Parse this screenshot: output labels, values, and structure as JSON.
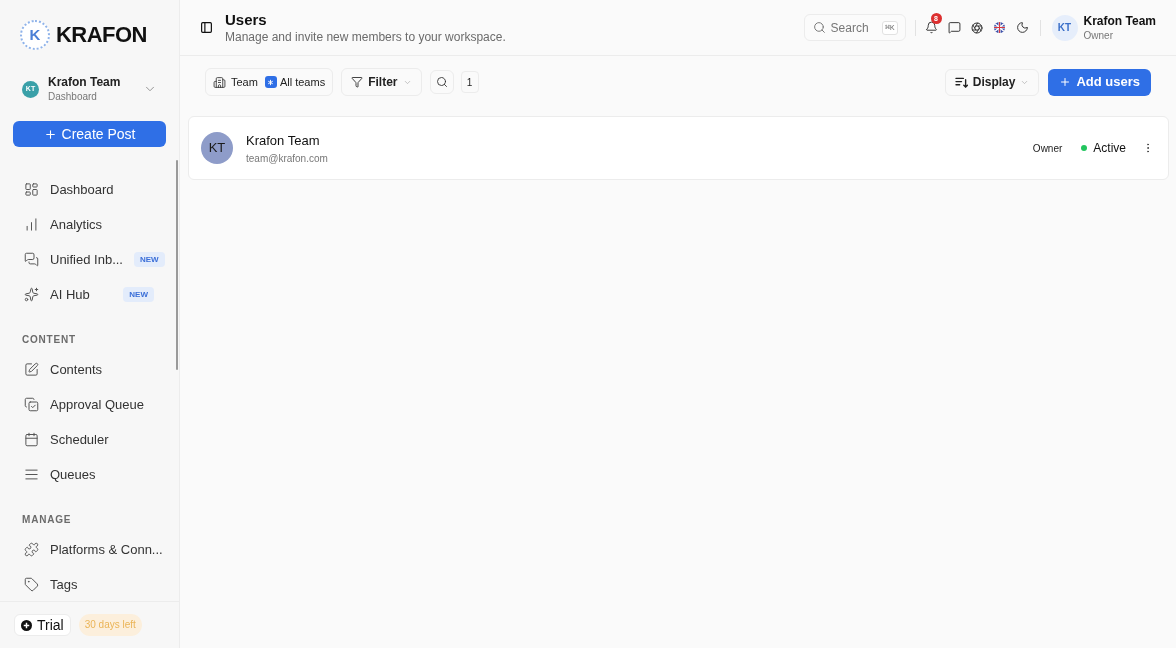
{
  "brand": {
    "mark": "K",
    "name": "KRAFON"
  },
  "workspace": {
    "avatar": "KT",
    "name": "Krafon Team",
    "subtitle": "Dashboard"
  },
  "create_button": {
    "label": "Create Post"
  },
  "nav_groups": [
    {
      "items": [
        {
          "label": "Dashboard",
          "selected": false
        },
        {
          "label": "Analytics",
          "selected": false
        },
        {
          "label": "Unified Inb...",
          "badge": "NEW",
          "selected": false
        },
        {
          "label": "AI Hub",
          "badge": "NEW",
          "selected": false
        }
      ]
    },
    {
      "title": "CONTENT",
      "items": [
        {
          "label": "Contents",
          "selected": false
        },
        {
          "label": "Approval Queue",
          "selected": false
        },
        {
          "label": "Scheduler",
          "selected": false
        },
        {
          "label": "Queues",
          "selected": false
        }
      ]
    },
    {
      "title": "MANAGE",
      "items": [
        {
          "label": "Platforms & Conn...",
          "selected": false
        },
        {
          "label": "Tags",
          "selected": false
        }
      ]
    }
  ],
  "trial": {
    "label": "Trial",
    "note": "30 days left"
  },
  "header": {
    "title": "Users",
    "subtitle": "Manage and invite new members to your workspace.",
    "search": {
      "placeholder": "Search",
      "shortcut": "⌘K"
    },
    "notifications": "8",
    "user": {
      "avatar": "KT",
      "name": "Krafon Team",
      "role": "Owner"
    }
  },
  "toolbar": {
    "team_label": "Team",
    "team_value": "All teams",
    "filter": "Filter",
    "count": "1",
    "display": "Display",
    "add_button": "Add users"
  },
  "users": [
    {
      "avatar": "KT",
      "name": "Krafon Team",
      "email": "team@krafon.com",
      "role": "Owner",
      "status": "Active",
      "color": "#22c55e"
    }
  ]
}
